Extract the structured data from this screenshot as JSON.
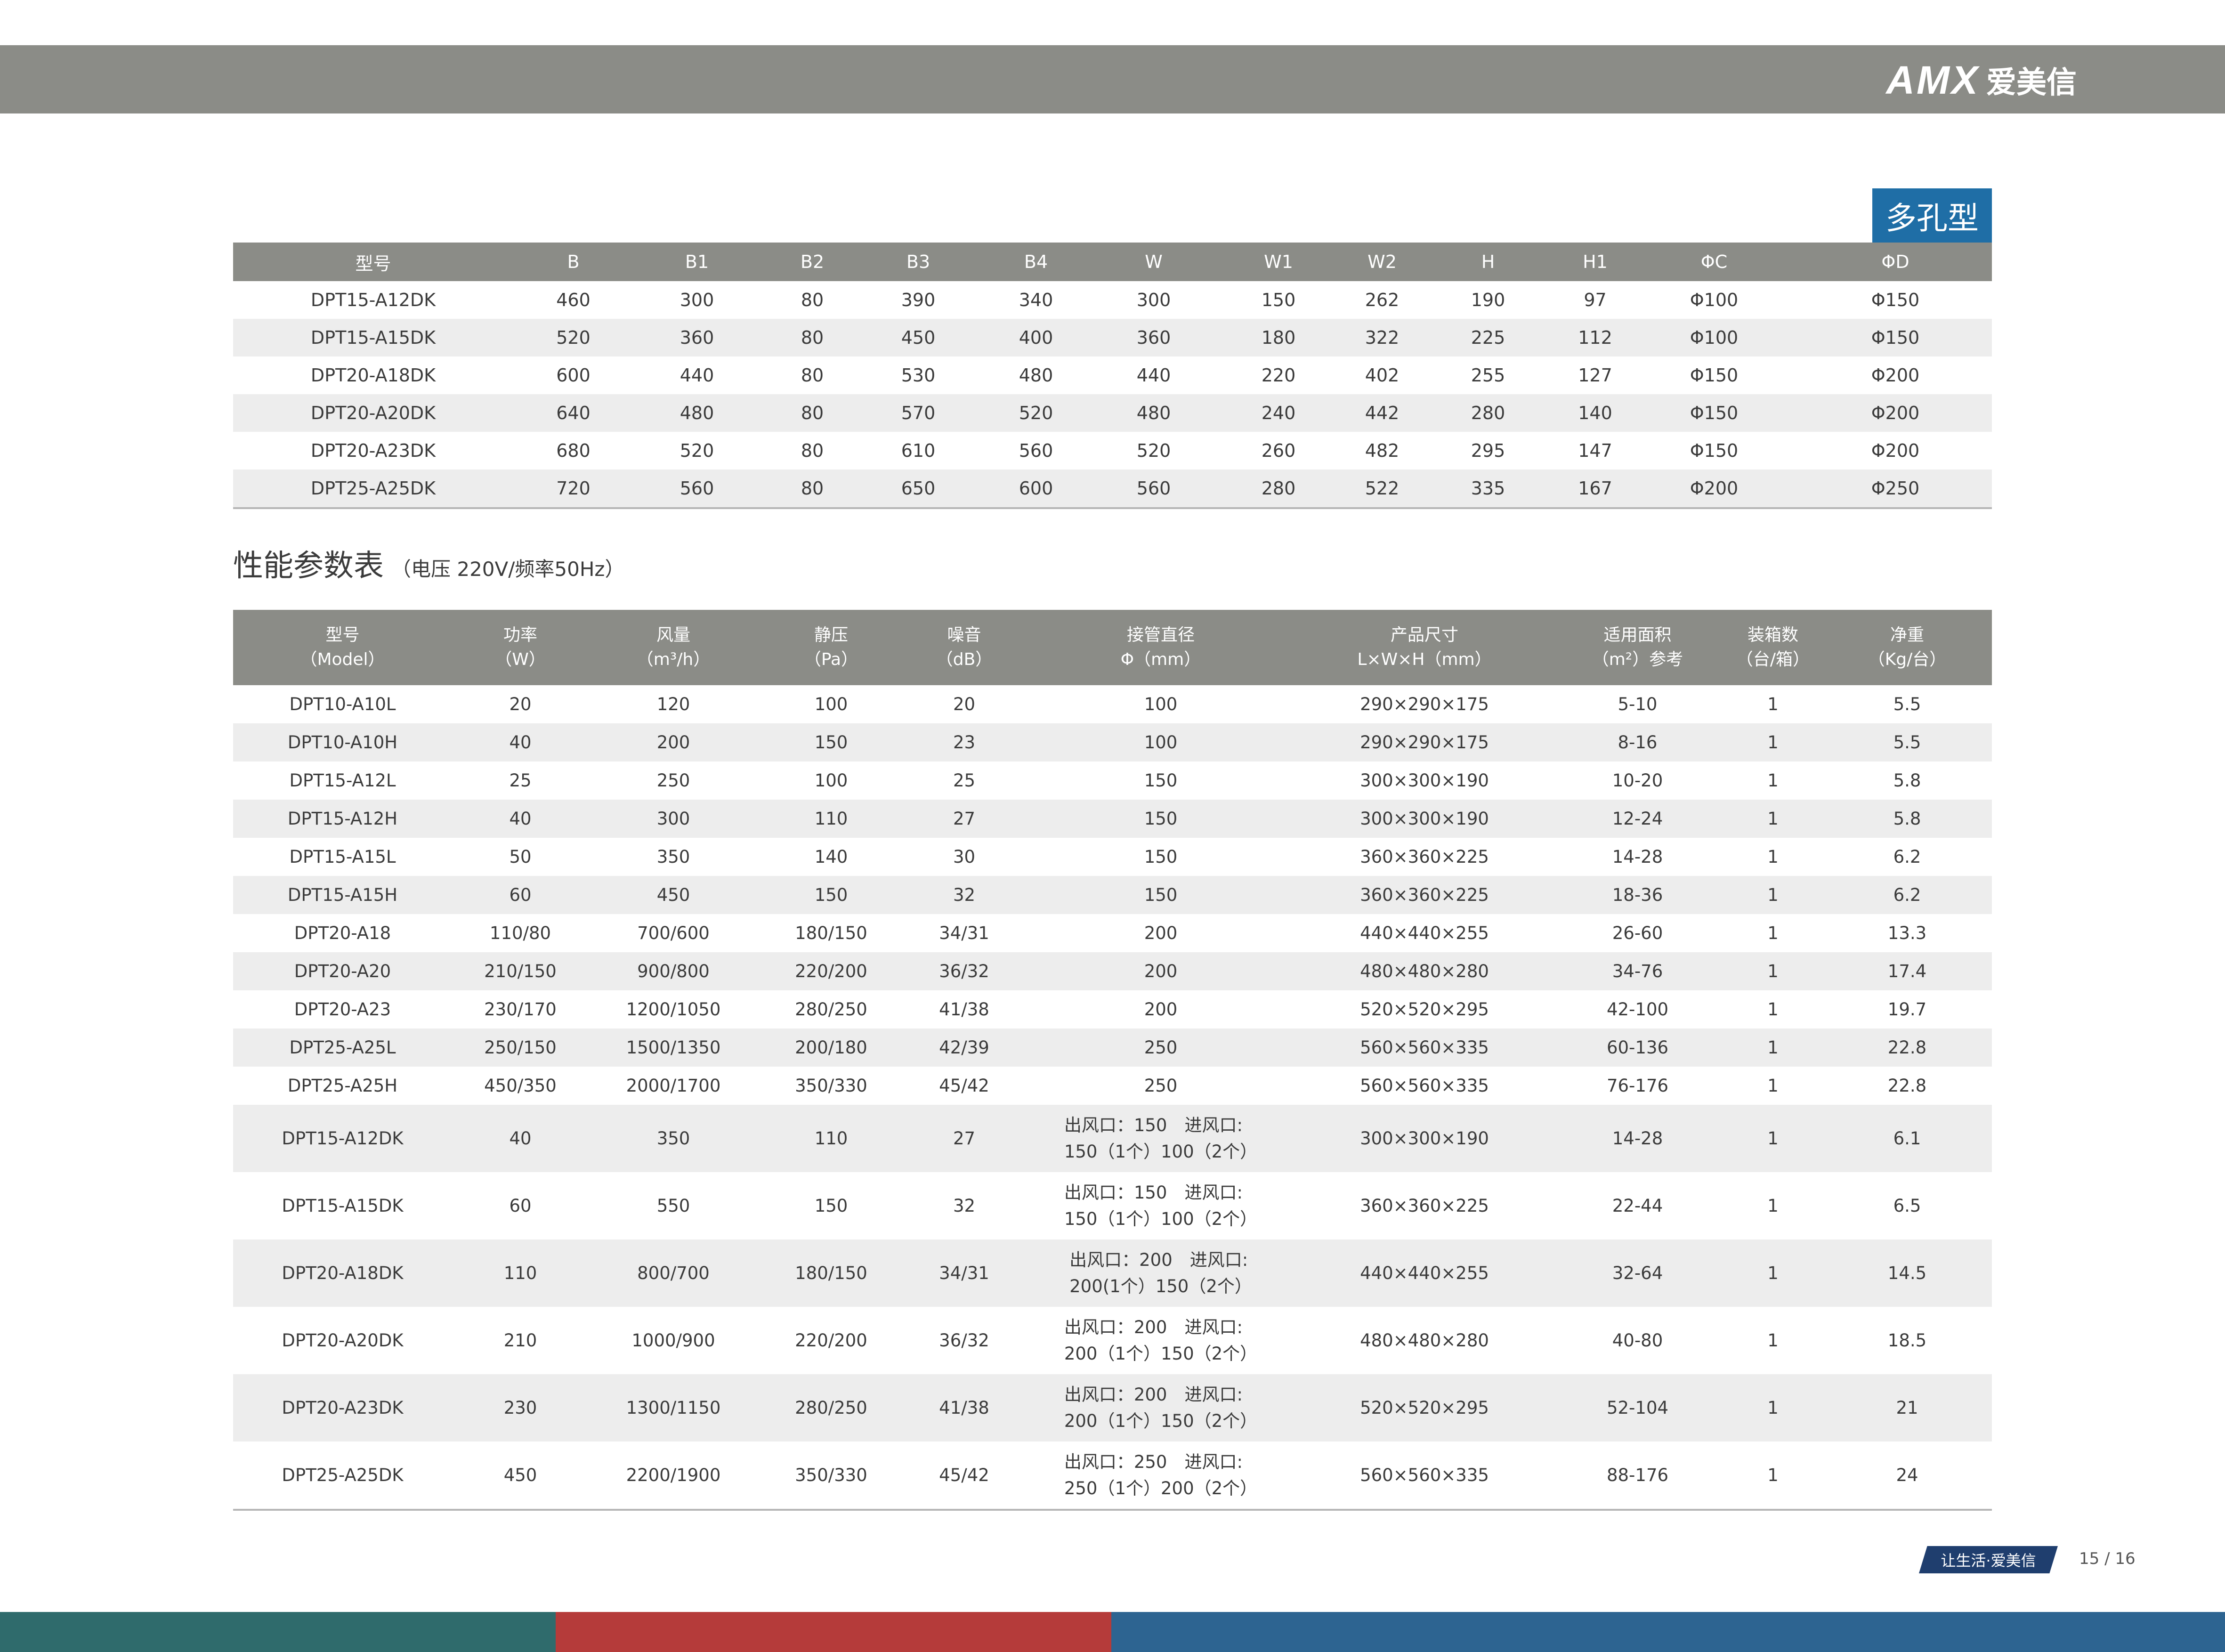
{
  "brand": {
    "logo_latin": "AMX",
    "logo_cjk": "爱美信"
  },
  "badge": "多孔型",
  "dimension_table": {
    "headers": [
      "型号",
      "B",
      "B1",
      "B2",
      "B3",
      "B4",
      "W",
      "W1",
      "W2",
      "H",
      "H1",
      "ΦC",
      "ΦD"
    ],
    "rows": [
      [
        "DPT15-A12DK",
        "460",
        "300",
        "80",
        "390",
        "340",
        "300",
        "150",
        "262",
        "190",
        "97",
        "Φ100",
        "Φ150"
      ],
      [
        "DPT15-A15DK",
        "520",
        "360",
        "80",
        "450",
        "400",
        "360",
        "180",
        "322",
        "225",
        "112",
        "Φ100",
        "Φ150"
      ],
      [
        "DPT20-A18DK",
        "600",
        "440",
        "80",
        "530",
        "480",
        "440",
        "220",
        "402",
        "255",
        "127",
        "Φ150",
        "Φ200"
      ],
      [
        "DPT20-A20DK",
        "640",
        "480",
        "80",
        "570",
        "520",
        "480",
        "240",
        "442",
        "280",
        "140",
        "Φ150",
        "Φ200"
      ],
      [
        "DPT20-A23DK",
        "680",
        "520",
        "80",
        "610",
        "560",
        "520",
        "260",
        "482",
        "295",
        "147",
        "Φ150",
        "Φ200"
      ],
      [
        "DPT25-A25DK",
        "720",
        "560",
        "80",
        "650",
        "600",
        "560",
        "280",
        "522",
        "335",
        "167",
        "Φ200",
        "Φ250"
      ]
    ]
  },
  "performance_section": {
    "title": "性能参数表",
    "subtitle": "（电压 220V/频率50Hz）"
  },
  "performance_table": {
    "headers": [
      [
        "型号",
        "（Model）"
      ],
      [
        "功率",
        "（W）"
      ],
      [
        "风量",
        "（m³/h）"
      ],
      [
        "静压",
        "（Pa）"
      ],
      [
        "噪音",
        "（dB）"
      ],
      [
        "接管直径",
        "Φ（mm）"
      ],
      [
        "产品尺寸",
        "L×W×H（mm）"
      ],
      [
        "适用面积",
        "（m²）参考"
      ],
      [
        "装箱数",
        "（台/箱）"
      ],
      [
        "净重",
        "（Kg/台）"
      ]
    ],
    "rows": [
      [
        "DPT10-A10L",
        "20",
        "120",
        "100",
        "20",
        [
          "100"
        ],
        "290×290×175",
        "5-10",
        "1",
        "5.5"
      ],
      [
        "DPT10-A10H",
        "40",
        "200",
        "150",
        "23",
        [
          "100"
        ],
        "290×290×175",
        "8-16",
        "1",
        "5.5"
      ],
      [
        "DPT15-A12L",
        "25",
        "250",
        "100",
        "25",
        [
          "150"
        ],
        "300×300×190",
        "10-20",
        "1",
        "5.8"
      ],
      [
        "DPT15-A12H",
        "40",
        "300",
        "110",
        "27",
        [
          "150"
        ],
        "300×300×190",
        "12-24",
        "1",
        "5.8"
      ],
      [
        "DPT15-A15L",
        "50",
        "350",
        "140",
        "30",
        [
          "150"
        ],
        "360×360×225",
        "14-28",
        "1",
        "6.2"
      ],
      [
        "DPT15-A15H",
        "60",
        "450",
        "150",
        "32",
        [
          "150"
        ],
        "360×360×225",
        "18-36",
        "1",
        "6.2"
      ],
      [
        "DPT20-A18",
        "110/80",
        "700/600",
        "180/150",
        "34/31",
        [
          "200"
        ],
        "440×440×255",
        "26-60",
        "1",
        "13.3"
      ],
      [
        "DPT20-A20",
        "210/150",
        "900/800",
        "220/200",
        "36/32",
        [
          "200"
        ],
        "480×480×280",
        "34-76",
        "1",
        "17.4"
      ],
      [
        "DPT20-A23",
        "230/170",
        "1200/1050",
        "280/250",
        "41/38",
        [
          "200"
        ],
        "520×520×295",
        "42-100",
        "1",
        "19.7"
      ],
      [
        "DPT25-A25L",
        "250/150",
        "1500/1350",
        "200/180",
        "42/39",
        [
          "250"
        ],
        "560×560×335",
        "60-136",
        "1",
        "22.8"
      ],
      [
        "DPT25-A25H",
        "450/350",
        "2000/1700",
        "350/330",
        "45/42",
        [
          "250"
        ],
        "560×560×335",
        "76-176",
        "1",
        "22.8"
      ],
      [
        "DPT15-A12DK",
        "40",
        "350",
        "110",
        "27",
        [
          "出风口：150　进风口:",
          "150（1个）100（2个）"
        ],
        "300×300×190",
        "14-28",
        "1",
        "6.1"
      ],
      [
        "DPT15-A15DK",
        "60",
        "550",
        "150",
        "32",
        [
          "出风口：150　进风口:",
          "150（1个）100（2个）"
        ],
        "360×360×225",
        "22-44",
        "1",
        "6.5"
      ],
      [
        "DPT20-A18DK",
        "110",
        "800/700",
        "180/150",
        "34/31",
        [
          "出风口：200　进风口:",
          "200(1个）150（2个）"
        ],
        "440×440×255",
        "32-64",
        "1",
        "14.5"
      ],
      [
        "DPT20-A20DK",
        "210",
        "1000/900",
        "220/200",
        "36/32",
        [
          "出风口：200　进风口:",
          "200（1个）150（2个）"
        ],
        "480×480×280",
        "40-80",
        "1",
        "18.5"
      ],
      [
        "DPT20-A23DK",
        "230",
        "1300/1150",
        "280/250",
        "41/38",
        [
          "出风口：200　进风口:",
          "200（1个）150（2个）"
        ],
        "520×520×295",
        "52-104",
        "1",
        "21"
      ],
      [
        "DPT25-A25DK",
        "450",
        "2200/1900",
        "350/330",
        "45/42",
        [
          "出风口：250　进风口:",
          "250（1个）200（2个）"
        ],
        "560×560×335",
        "88-176",
        "1",
        "24"
      ]
    ]
  },
  "footer": {
    "slogan": "让生活·爱美信",
    "page": "15 / 16"
  },
  "colors": {
    "top_bar": "#8b8c87",
    "header_bg": "#8b8c87",
    "badge_bg": "#1f6ea6",
    "row_alt": "#ededed",
    "slogan_bg": "#1f3e6e",
    "bottom_stripes": [
      "#2f6b6c",
      "#b53b3a",
      "#2d6491"
    ]
  }
}
